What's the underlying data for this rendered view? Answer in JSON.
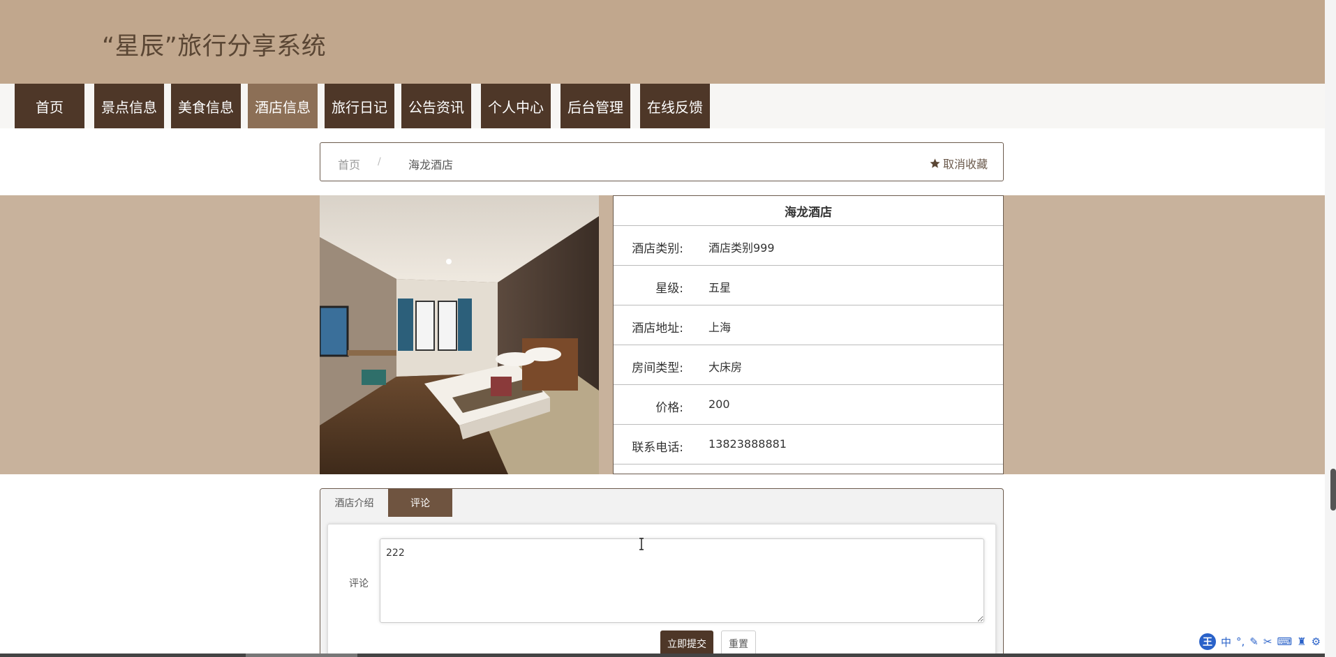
{
  "site": {
    "title": "“星辰”旅行分享系统"
  },
  "nav": {
    "items": [
      {
        "label": "首页"
      },
      {
        "label": "景点信息"
      },
      {
        "label": "美食信息"
      },
      {
        "label": "酒店信息"
      },
      {
        "label": "旅行日记"
      },
      {
        "label": "公告资讯"
      },
      {
        "label": "个人中心"
      },
      {
        "label": "后台管理"
      },
      {
        "label": "在线反馈"
      }
    ],
    "active": "酒店信息"
  },
  "breadcrumb": {
    "home": "首页",
    "separator": "/",
    "current": "海龙酒店"
  },
  "favorite": {
    "label": "取消收藏",
    "icon": "star-icon"
  },
  "hotel": {
    "name": "海龙酒店",
    "fields": [
      {
        "label": "酒店类别:",
        "value": "酒店类别999"
      },
      {
        "label": "星级:",
        "value": "五星"
      },
      {
        "label": "酒店地址:",
        "value": "上海"
      },
      {
        "label": "房间类型:",
        "value": "大床房"
      },
      {
        "label": "价格:",
        "value": "200"
      },
      {
        "label": "联系电话:",
        "value": "13823888881"
      }
    ]
  },
  "tabs": {
    "intro": "酒店介绍",
    "comment": "评论",
    "active": "评论"
  },
  "comment_form": {
    "label": "评论",
    "value": "222",
    "submit": "立即提交",
    "reset": "重置"
  },
  "ime": {
    "logo": "王",
    "mode": "中",
    "punct": "°,"
  },
  "colors": {
    "header": "#c1a78d",
    "nav": "#4e3728",
    "nav_active": "#8c6f56",
    "band": "#c8b29c",
    "tab_active": "#6f5440",
    "accent": "#6b5a4c"
  }
}
